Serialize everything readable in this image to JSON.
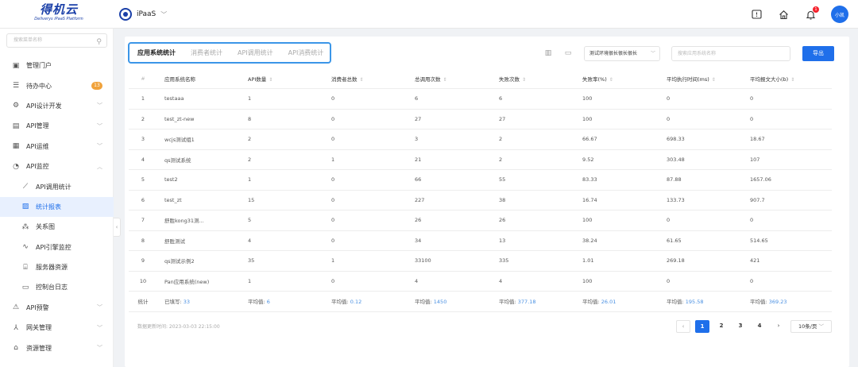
{
  "brand": {
    "logo_text": "得机云",
    "logo_sub": "Deliverys iPaaS Platform"
  },
  "header": {
    "app_name": "iPaaS",
    "avatar_text": "小凯",
    "notification_count": "1"
  },
  "sidebar": {
    "search_placeholder": "搜索菜单名称",
    "items": [
      {
        "label": "管理门户",
        "icon": "portal-icon"
      },
      {
        "label": "待办中心",
        "icon": "todo-icon",
        "badge": "13"
      },
      {
        "label": "API设计开发",
        "icon": "dev-icon"
      },
      {
        "label": "API管理",
        "icon": "manage-icon"
      },
      {
        "label": "API运维",
        "icon": "ops-icon"
      },
      {
        "label": "API监控",
        "icon": "monitor-icon"
      },
      {
        "label": "API调用统计",
        "icon": "line-chart-icon"
      },
      {
        "label": "统计报表",
        "icon": "report-icon"
      },
      {
        "label": "关系图",
        "icon": "relation-icon"
      },
      {
        "label": "API引擎监控",
        "icon": "engine-icon"
      },
      {
        "label": "服务器资源",
        "icon": "server-icon"
      },
      {
        "label": "控制台日志",
        "icon": "log-icon"
      },
      {
        "label": "API预警",
        "icon": "alert-icon"
      },
      {
        "label": "网关管理",
        "icon": "gateway-icon"
      },
      {
        "label": "资源管理",
        "icon": "resource-icon"
      }
    ]
  },
  "tabs": [
    "应用系统统计",
    "消费者统计",
    "API调用统计",
    "API消费统计"
  ],
  "filters": {
    "env_select": "测试环境很长很长很长",
    "search_placeholder": "搜索应用系统名称",
    "export_label": "导出"
  },
  "table": {
    "columns": [
      "#",
      "应用系统名称",
      "API数量",
      "消费者总数",
      "总调用次数",
      "失败次数",
      "失败率(%)",
      "平均执行时间(ms)",
      "平均报文大小(b)"
    ],
    "rows": [
      [
        "1",
        "testaaa",
        "1",
        "0",
        "6",
        "6",
        "100",
        "0",
        "0"
      ],
      [
        "2",
        "test_zt-new",
        "8",
        "0",
        "27",
        "27",
        "100",
        "0",
        "0"
      ],
      [
        "3",
        "wcjs测试组1",
        "2",
        "0",
        "3",
        "2",
        "66.67",
        "698.33",
        "18.67"
      ],
      [
        "4",
        "qs测试系统",
        "2",
        "1",
        "21",
        "2",
        "9.52",
        "303.48",
        "107"
      ],
      [
        "5",
        "test2",
        "1",
        "0",
        "66",
        "55",
        "83.33",
        "87.88",
        "1657.06"
      ],
      [
        "6",
        "test_zt",
        "15",
        "0",
        "227",
        "38",
        "16.74",
        "133.73",
        "907.7"
      ],
      [
        "7",
        "舒胜kong31测...",
        "5",
        "0",
        "26",
        "26",
        "100",
        "0",
        "0"
      ],
      [
        "8",
        "舒胜测试",
        "4",
        "0",
        "34",
        "13",
        "38.24",
        "61.65",
        "514.65"
      ],
      [
        "9",
        "qs测试示例2",
        "35",
        "1",
        "33100",
        "335",
        "1.01",
        "269.18",
        "421"
      ],
      [
        "10",
        "Pan应用系统(new)",
        "1",
        "0",
        "4",
        "4",
        "100",
        "0",
        "0"
      ]
    ],
    "summary": {
      "label": "统计",
      "filled_label": "已填写:",
      "filled_value": "33",
      "avg_label": "平均值:",
      "avgs": [
        "6",
        "0.12",
        "1450",
        "377.18",
        "26.01",
        "195.58",
        "369.23"
      ]
    }
  },
  "footer": {
    "update_time": "数据更新时间: 2023-03-03 22:15:00",
    "pages": [
      "1",
      "2",
      "3",
      "4"
    ],
    "current_page": "1",
    "page_size": "10条/页"
  },
  "colors": {
    "primary": "#1f6fea",
    "tab_border": "#3b96e8",
    "badge": "#f0a23b",
    "brand": "#1a3fa8"
  }
}
